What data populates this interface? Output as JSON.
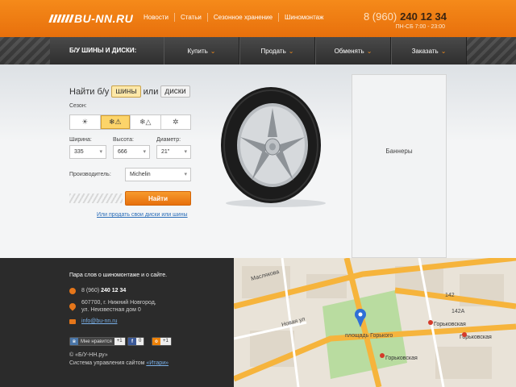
{
  "header": {
    "logo_text": "BU-NN.RU",
    "nav": [
      "Новости",
      "Статьи",
      "Сезонное хранение",
      "Шиномонтаж"
    ],
    "phone_code": "8 (960)",
    "phone_number": "240 12 34",
    "hours": "ПН-СБ  7:00 - 23:00",
    "accent_color": "#f0821a"
  },
  "menu": {
    "title": "Б/У ШИНЫ И ДИСКИ:",
    "items": [
      "Купить",
      "Продать",
      "Обменять",
      "Заказать"
    ]
  },
  "search": {
    "title_prefix": "Найти б/у",
    "chip_tires": "шины",
    "title_or": "или",
    "chip_disks": "диски",
    "season_label": "Сезон:",
    "season_icons": [
      "sun-icon",
      "all-season-icon",
      "winter-studded-icon",
      "snowflake-icon"
    ],
    "width_label": "Ширина:",
    "width_value": "335",
    "height_label": "Высота:",
    "height_value": "666",
    "diameter_label": "Диаметр:",
    "diameter_value": "21\"",
    "maker_label": "Производитель:",
    "maker_value": "Michelin",
    "find_button": "Найти",
    "sell_link": "Или продать свои диски или шины"
  },
  "banner": {
    "label": "Баннеры"
  },
  "footer": {
    "tagline": "Пара слов о шиномонтаже и о сайте.",
    "phone_code": "8 (960)",
    "phone_number": "240 12 34",
    "address_line1": "607700, г. Нижний Новгород,",
    "address_line2": "ул. Неизвестная дом 0",
    "email": "info@bu-nn.ru",
    "social": [
      {
        "icon": "vk-icon",
        "label": "Мне нравится",
        "count": "+1"
      },
      {
        "icon": "facebook-icon",
        "label": "",
        "count": "0"
      },
      {
        "icon": "odnoklassniki-icon",
        "label": "",
        "count": "+1"
      }
    ],
    "copyright": "© «Б/У-НН.ру»",
    "cms_prefix": "Система управления сайтом",
    "cms_link": "«Итари»"
  },
  "map": {
    "labels": [
      "Маслякова",
      "площадь Горького",
      "Горьковская",
      "Горьковская",
      "Горьковская",
      "142",
      "142А",
      "Новая ул"
    ]
  }
}
